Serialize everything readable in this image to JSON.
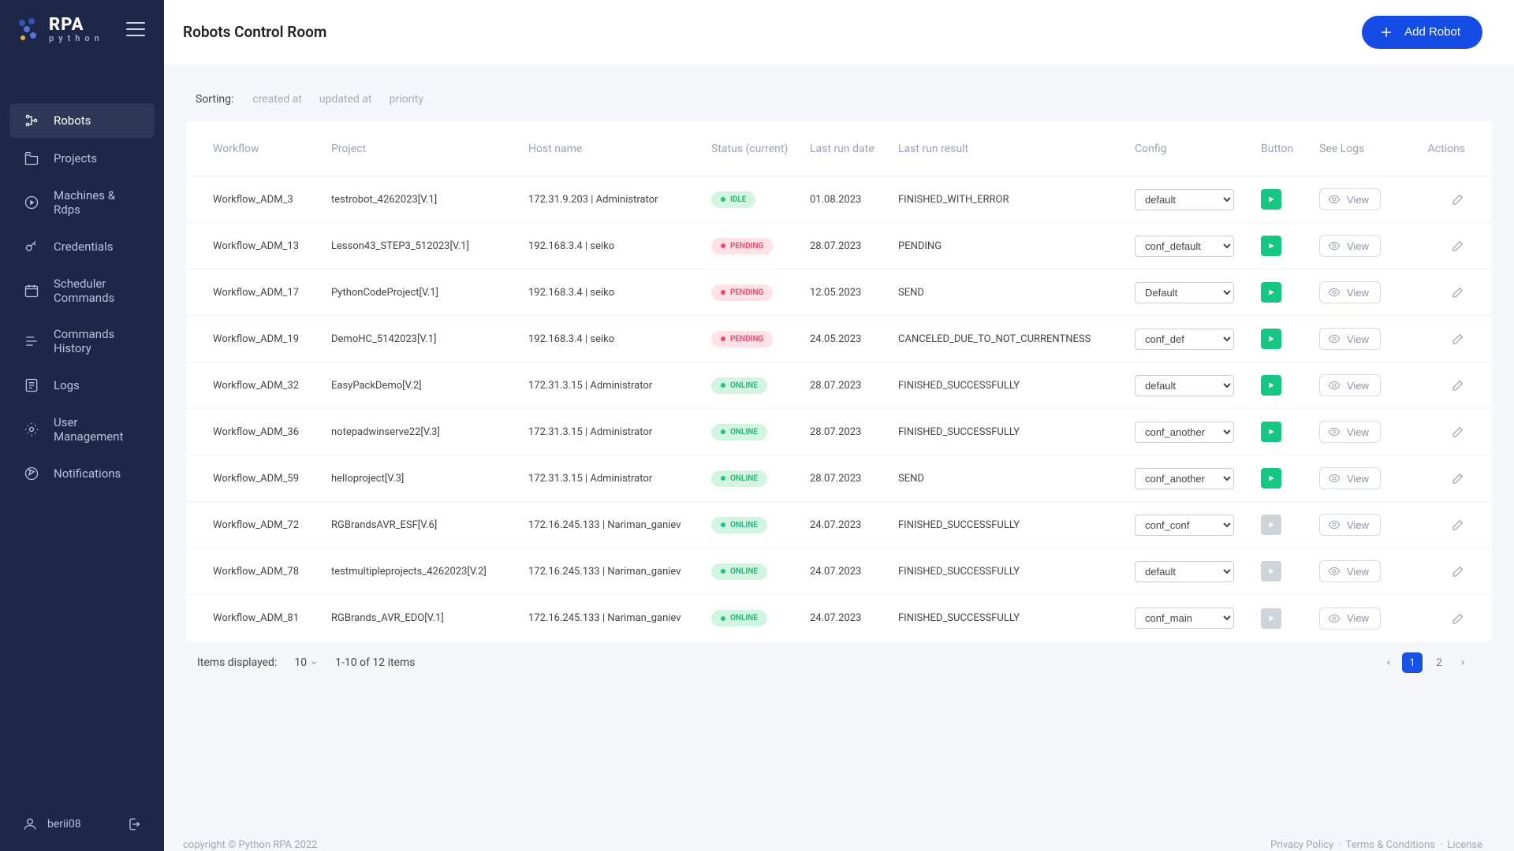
{
  "brand": {
    "name": "RPA",
    "sub": "python"
  },
  "nav": {
    "items": [
      {
        "label": "Robots",
        "icon": "robots",
        "active": true
      },
      {
        "label": "Projects",
        "icon": "projects"
      },
      {
        "label": "Machines & Rdps",
        "icon": "machines"
      },
      {
        "label": "Credentials",
        "icon": "credentials"
      },
      {
        "label": "Scheduler Commands",
        "icon": "scheduler"
      },
      {
        "label": "Commands History",
        "icon": "history"
      },
      {
        "label": "Logs",
        "icon": "logs"
      },
      {
        "label": "User Management",
        "icon": "users"
      },
      {
        "label": "Notifications",
        "icon": "notifications"
      }
    ]
  },
  "user": {
    "name": "berii08"
  },
  "header": {
    "title": "Robots Control Room",
    "addLabel": "Add Robot"
  },
  "sorting": {
    "label": "Sorting:",
    "options": [
      "created at",
      "updated at",
      "priority"
    ]
  },
  "table": {
    "columns": {
      "workflow": "Workflow",
      "project": "Project",
      "host": "Host name",
      "status": "Status (current)",
      "lastRunDate": "Last run date",
      "lastRunResult": "Last run result",
      "config": "Config",
      "button": "Button",
      "seeLogs": "See Logs",
      "actions": "Actions"
    },
    "viewLabel": "View",
    "rows": [
      {
        "workflow": "Workflow_ADM_3",
        "project": "testrobot_4262023[V.1]",
        "host": "172.31.9.203 | Administrator",
        "status": "IDLE",
        "date": "01.08.2023",
        "result": "FINISHED_WITH_ERROR",
        "config": "default",
        "runEnabled": true
      },
      {
        "workflow": "Workflow_ADM_13",
        "project": "Lesson43_STEP3_512023[V.1]",
        "host": "192.168.3.4 | seiko",
        "status": "PENDING",
        "date": "28.07.2023",
        "result": "PENDING",
        "config": "conf_default",
        "runEnabled": true
      },
      {
        "workflow": "Workflow_ADM_17",
        "project": "PythonCodeProject[V.1]",
        "host": "192.168.3.4 | seiko",
        "status": "PENDING",
        "date": "12.05.2023",
        "result": "SEND",
        "config": "Default",
        "runEnabled": true
      },
      {
        "workflow": "Workflow_ADM_19",
        "project": "DemoHC_5142023[V.1]",
        "host": "192.168.3.4 | seiko",
        "status": "PENDING",
        "date": "24.05.2023",
        "result": "CANCELED_DUE_TO_NOT_CURRENTNESS",
        "config": "conf_def",
        "runEnabled": true
      },
      {
        "workflow": "Workflow_ADM_32",
        "project": "EasyPackDemo[V.2]",
        "host": "172.31.3.15 | Administrator",
        "status": "ONLINE",
        "date": "28.07.2023",
        "result": "FINISHED_SUCCESSFULLY",
        "config": "default",
        "runEnabled": true
      },
      {
        "workflow": "Workflow_ADM_36",
        "project": "notepadwinserve22[V.3]",
        "host": "172.31.3.15 | Administrator",
        "status": "ONLINE",
        "date": "28.07.2023",
        "result": "FINISHED_SUCCESSFULLY",
        "config": "conf_another",
        "runEnabled": true
      },
      {
        "workflow": "Workflow_ADM_59",
        "project": "helloproject[V.3]",
        "host": "172.31.3.15 | Administrator",
        "status": "ONLINE",
        "date": "28.07.2023",
        "result": "SEND",
        "config": "conf_another",
        "runEnabled": true
      },
      {
        "workflow": "Workflow_ADM_72",
        "project": "RGBrandsAVR_ESF[V.6]",
        "host": "172.16.245.133 | Nariman_ganiev",
        "status": "ONLINE",
        "date": "24.07.2023",
        "result": "FINISHED_SUCCESSFULLY",
        "config": "conf_conf",
        "runEnabled": false
      },
      {
        "workflow": "Workflow_ADM_78",
        "project": "testmultipleprojects_4262023[V.2]",
        "host": "172.16.245.133 | Nariman_ganiev",
        "status": "ONLINE",
        "date": "24.07.2023",
        "result": "FINISHED_SUCCESSFULLY",
        "config": "default",
        "runEnabled": false
      },
      {
        "workflow": "Workflow_ADM_81",
        "project": "RGBrands_AVR_EDO[V.1]",
        "host": "172.16.245.133 | Nariman_ganiev",
        "status": "ONLINE",
        "date": "24.07.2023",
        "result": "FINISHED_SUCCESSFULLY",
        "config": "conf_main",
        "runEnabled": false
      }
    ]
  },
  "pager": {
    "itemsLabel": "Items displayed:",
    "pageSize": "10",
    "range": "1-10 of 12 items",
    "pages": [
      "1",
      "2"
    ],
    "current": "1"
  },
  "footer": {
    "copyright": "copyright © Python RPA 2022",
    "links": [
      "Privacy Policy",
      "Terms & Conditions",
      "License"
    ]
  },
  "colors": {
    "accent": "#164ce6",
    "sidebar": "#1d2748",
    "success": "#16c784",
    "pending": "#ef476f"
  }
}
